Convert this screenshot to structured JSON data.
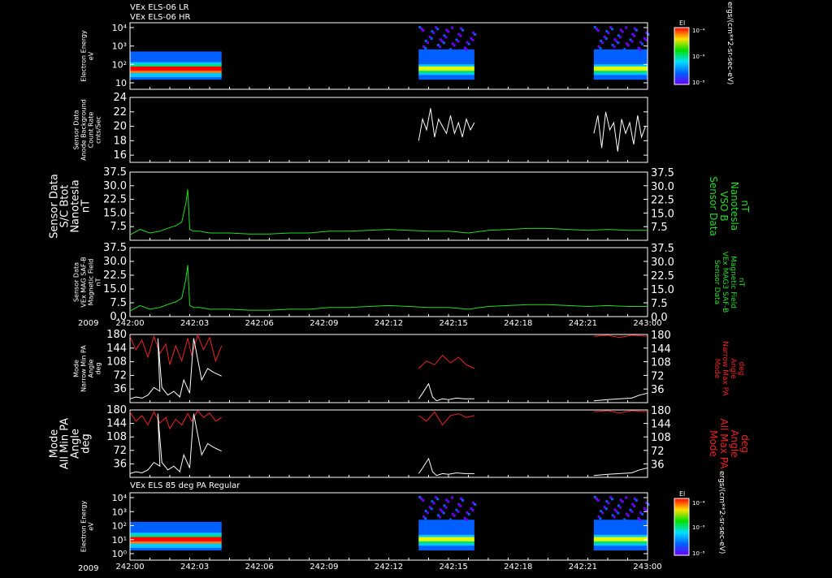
{
  "titles": {
    "top1": "VEx ELS-06 LR",
    "top2": "VEx ELS-06 HR",
    "bottom": "VEx ELS 85 deg PA Regular"
  },
  "year_label": "2009",
  "x_ticks": [
    "242:00",
    "242:03",
    "242:06",
    "242:09",
    "242:12",
    "242:15",
    "242:18",
    "242:21",
    "243:00"
  ],
  "colors": {
    "background": "#000000",
    "axes": "#ffffff",
    "green": "#22dd22",
    "red": "#ee2222",
    "white": "#ffffff"
  },
  "colorbar": {
    "label": "El",
    "units_top": "ergs/(cm**2-sr-sec-eV)",
    "units_bottom": "ergs/(cm**2-sr-sec-eV)",
    "ticks_top": [
      "10⁻⁴",
      "10⁻⁶",
      "10⁻⁸"
    ],
    "ticks_bottom": [
      "10⁻⁴",
      "10⁻⁶",
      "10⁻⁸"
    ]
  },
  "panels": [
    {
      "id": "p1",
      "ylabel": [
        "Electron Energy",
        "eV"
      ],
      "yticks": [
        "10⁴",
        "10³",
        "10²",
        "10"
      ]
    },
    {
      "id": "p2",
      "ylabel": [
        "Sensor Data",
        "Anode Background",
        "Count Rate",
        "cnts/Sec"
      ],
      "yticks": [
        "24",
        "22",
        "20",
        "18",
        "16"
      ]
    },
    {
      "id": "p3",
      "ylabel": [
        "Sensor Data",
        "S/C Btot",
        "Nanotesla",
        "nT"
      ],
      "ylabel_right": [
        "Sensor Data",
        "VSO B",
        "Nanotesla",
        "nT"
      ],
      "yticks": [
        "37.5",
        "30.0",
        "22.5",
        "15.0",
        "7.5"
      ]
    },
    {
      "id": "p4",
      "ylabel": [
        "Sensor Data",
        "VEx MAG SAF-B",
        "Magnetic Field",
        "nT"
      ],
      "ylabel_right": [
        "Sensor Data",
        "VEx MAG3 SAF-B",
        "Magnetic Field",
        "nT"
      ],
      "yticks": [
        "37.5",
        "30.0",
        "22.5",
        "15.0",
        "7.5",
        "0.0"
      ]
    },
    {
      "id": "p5",
      "ylabel": [
        "Mode",
        "Narrow Min PA",
        "Angle",
        "deg"
      ],
      "ylabel_right": [
        "Mode",
        "Narrow Max PA",
        "Angle",
        "deg"
      ],
      "yticks": [
        "180",
        "144",
        "108",
        "72",
        "36"
      ]
    },
    {
      "id": "p6",
      "ylabel": [
        "Mode",
        "All Min PA",
        "Angle",
        "deg"
      ],
      "ylabel_right": [
        "Mode",
        "All Max PA",
        "Angle",
        "deg"
      ],
      "yticks": [
        "180",
        "144",
        "108",
        "72",
        "36"
      ]
    },
    {
      "id": "p7",
      "ylabel": [
        "Electron Energy",
        "eV"
      ],
      "yticks": [
        "10⁴",
        "10³",
        "10²",
        "10¹",
        "10⁰"
      ]
    }
  ],
  "chart_data": {
    "type": "line",
    "x_range_hours": [
      "242:00",
      "243:00"
    ],
    "data_segments_hours": [
      [
        0.0,
        4.6
      ],
      [
        14.5,
        17.3
      ],
      [
        23.3,
        26.0
      ]
    ],
    "panels": [
      {
        "id": "p1",
        "type": "heatmap",
        "ylim": [
          1,
          10000
        ],
        "log": true,
        "series": []
      },
      {
        "id": "p2",
        "type": "line",
        "ylim": [
          15,
          24
        ],
        "series": [
          {
            "color": "white",
            "x": [
              14.5,
              14.7,
              14.9,
              15.1,
              15.3,
              15.5,
              15.7,
              15.9,
              16.1,
              16.3,
              16.5,
              16.7,
              16.9,
              17.1,
              17.3
            ],
            "y": [
              18,
              21,
              19.5,
              22.5,
              18.5,
              21,
              20,
              19,
              21.5,
              19,
              20.5,
              18.5,
              21,
              19.5,
              20.5
            ]
          },
          {
            "color": "white",
            "x": [
              23.3,
              23.5,
              23.7,
              23.9,
              24.1,
              24.3,
              24.5,
              24.7,
              24.9,
              25.1,
              25.3,
              25.5,
              25.7,
              25.9
            ],
            "y": [
              19,
              21.5,
              17,
              22,
              19.5,
              20.5,
              16.5,
              21,
              19,
              20.5,
              17.5,
              21.5,
              18.5,
              20
            ]
          }
        ]
      },
      {
        "id": "p3",
        "type": "line",
        "ylim": [
          0,
          37.5
        ],
        "series": [
          {
            "color": "green",
            "x": [
              0,
              0.5,
              1,
              1.5,
              2,
              2.3,
              2.6,
              2.8,
              2.9,
              3.0,
              3.2,
              3.5,
              4,
              5,
              6,
              7,
              8,
              9,
              10,
              11,
              12,
              13,
              14,
              15,
              16,
              17,
              18,
              19,
              20,
              21,
              22,
              23,
              24,
              25,
              26
            ],
            "y": [
              3,
              6,
              4,
              5,
              7,
              8,
              10,
              20,
              28,
              6,
              5,
              5,
              4,
              4,
              3.5,
              3.5,
              4,
              4,
              5,
              5,
              5.5,
              6,
              5.5,
              5,
              5,
              4,
              5.5,
              6,
              6.5,
              6.5,
              6,
              5.5,
              6,
              5.5,
              5.5
            ]
          }
        ]
      },
      {
        "id": "p4",
        "type": "line",
        "ylim": [
          0,
          37.5
        ],
        "series": [
          {
            "color": "green",
            "x": [
              0,
              0.5,
              1,
              1.5,
              2,
              2.3,
              2.6,
              2.8,
              2.9,
              3.0,
              3.2,
              3.5,
              4,
              5,
              6,
              7,
              8,
              9,
              10,
              11,
              12,
              13,
              14,
              15,
              16,
              17,
              18,
              19,
              20,
              21,
              22,
              23,
              24,
              25,
              26
            ],
            "y": [
              3,
              6,
              4,
              5,
              7,
              8,
              10,
              20,
              28,
              6,
              5,
              5,
              4,
              4,
              3.5,
              3.5,
              4,
              4,
              5,
              5,
              5.5,
              6,
              5.5,
              5,
              5,
              4,
              5.5,
              6,
              6.5,
              6.5,
              6,
              5.5,
              6,
              5.5,
              5.5
            ]
          }
        ]
      },
      {
        "id": "p5",
        "type": "line",
        "ylim": [
          0,
          180
        ],
        "series": [
          {
            "color": "red",
            "x": [
              0,
              0.3,
              0.6,
              0.9,
              1.2,
              1.5,
              1.8,
              2.0,
              2.3,
              2.6,
              2.9,
              3.1,
              3.4,
              3.7,
              4.0,
              4.3,
              4.6
            ],
            "y": [
              175,
              140,
              165,
              120,
              175,
              130,
              155,
              100,
              150,
              110,
              170,
              125,
              178,
              140,
              172,
              110,
              150
            ]
          },
          {
            "color": "red",
            "x": [
              14.5,
              14.9,
              15.3,
              15.7,
              16.1,
              16.5,
              16.9,
              17.3
            ],
            "y": [
              90,
              110,
              100,
              125,
              105,
              120,
              100,
              90
            ]
          },
          {
            "color": "red",
            "x": [
              23.3,
              24,
              24.6,
              25.2,
              26
            ],
            "y": [
              175,
              178,
              172,
              178,
              175
            ]
          },
          {
            "color": "white",
            "x": [
              0,
              0.3,
              0.6,
              0.9,
              1.2,
              1.5,
              1.4,
              1.6,
              1.9,
              2.2,
              2.5,
              2.7,
              3.0,
              3.2,
              3.6,
              3.9,
              4.2,
              4.6
            ],
            "y": [
              10,
              15,
              12,
              20,
              40,
              30,
              170,
              40,
              20,
              30,
              15,
              60,
              25,
              170,
              60,
              90,
              80,
              70
            ]
          },
          {
            "color": "white",
            "x": [
              14.5,
              14.7,
              15.0,
              15.2,
              15.4,
              15.7,
              16.0,
              16.4,
              16.8,
              17.3
            ],
            "y": [
              10,
              25,
              50,
              15,
              5,
              10,
              8,
              12,
              10,
              10
            ]
          },
          {
            "color": "white",
            "x": [
              23.3,
              24.0,
              24.6,
              25.2,
              25.6,
              26.0
            ],
            "y": [
              5,
              8,
              10,
              12,
              20,
              25
            ]
          }
        ]
      },
      {
        "id": "p6",
        "type": "line",
        "ylim": [
          0,
          180
        ],
        "series": [
          {
            "color": "red",
            "x": [
              0,
              0.3,
              0.6,
              0.9,
              1.2,
              1.5,
              1.8,
              2.0,
              2.3,
              2.6,
              2.9,
              3.1,
              3.4,
              3.7,
              4.0,
              4.3,
              4.6
            ],
            "y": [
              175,
              150,
              165,
              140,
              175,
              145,
              160,
              130,
              155,
              140,
              170,
              150,
              178,
              160,
              172,
              150,
              160
            ]
          },
          {
            "color": "red",
            "x": [
              14.5,
              14.9,
              15.3,
              15.7,
              16.1,
              16.5,
              16.9,
              17.3
            ],
            "y": [
              165,
              150,
              175,
              140,
              165,
              170,
              160,
              165
            ]
          },
          {
            "color": "red",
            "x": [
              23.3,
              24,
              24.6,
              25.2,
              26
            ],
            "y": [
              175,
              178,
              172,
              178,
              175
            ]
          },
          {
            "color": "white",
            "x": [
              0,
              0.3,
              0.6,
              0.9,
              1.2,
              1.5,
              1.4,
              1.6,
              1.9,
              2.2,
              2.5,
              2.7,
              3.0,
              3.2,
              3.6,
              3.9,
              4.2,
              4.6
            ],
            "y": [
              10,
              15,
              12,
              20,
              40,
              30,
              170,
              40,
              20,
              30,
              15,
              60,
              25,
              170,
              60,
              90,
              80,
              70
            ]
          },
          {
            "color": "white",
            "x": [
              14.5,
              14.7,
              15.0,
              15.2,
              15.4,
              15.7,
              16.0,
              16.4,
              16.8,
              17.3
            ],
            "y": [
              10,
              25,
              50,
              15,
              5,
              10,
              8,
              12,
              10,
              10
            ]
          },
          {
            "color": "white",
            "x": [
              23.3,
              24.0,
              24.6,
              25.2,
              25.6,
              26.0
            ],
            "y": [
              5,
              8,
              10,
              12,
              20,
              25
            ]
          }
        ]
      },
      {
        "id": "p7",
        "type": "heatmap",
        "ylim": [
          1,
          10000
        ],
        "log": true,
        "series": []
      }
    ]
  }
}
